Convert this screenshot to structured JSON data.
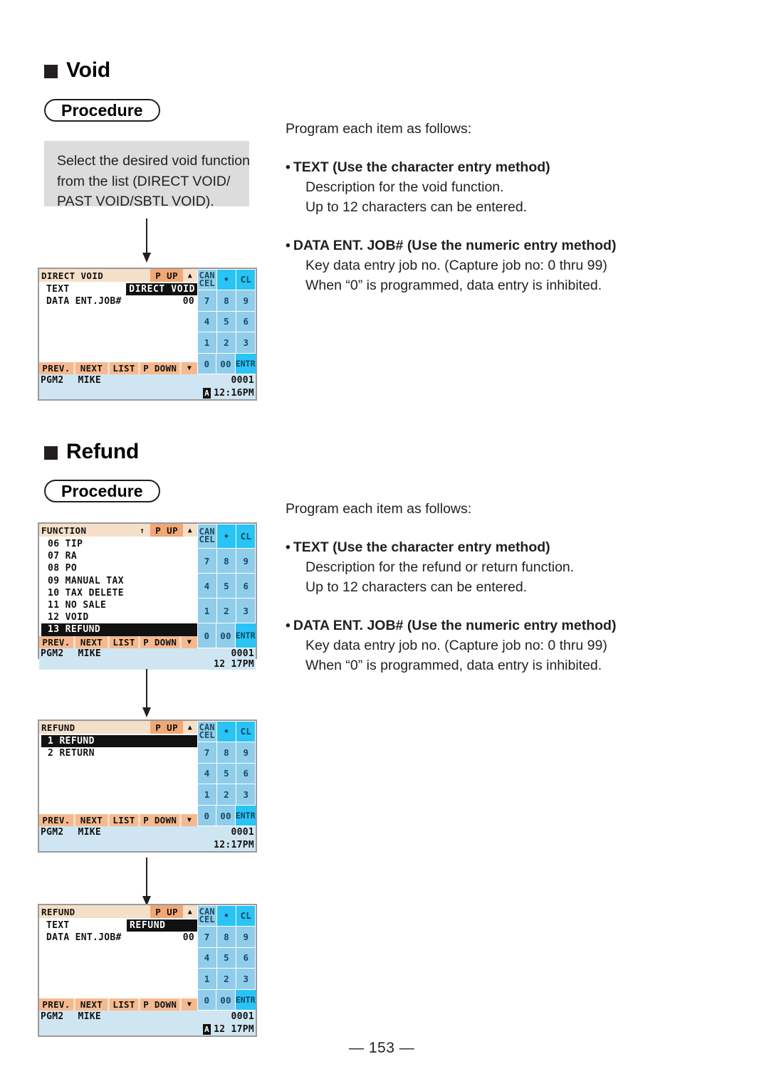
{
  "page": {
    "number_label": "— 153 —"
  },
  "sections": [
    {
      "heading": "Void",
      "procedure_label": "Procedure",
      "instruction": [
        "Select the desired void function",
        "from the list (DIRECT VOID/",
        "PAST VOID/SBTL VOID)."
      ],
      "prose": {
        "lead": "Program each item as follows:",
        "items": [
          {
            "title": "TEXT (Use the character entry method)",
            "lines": [
              "Description for the void function.",
              "Up to 12 characters can be entered."
            ]
          },
          {
            "title": "DATA ENT. JOB# (Use the numeric entry method)",
            "lines": [
              "Key data entry job no. (Capture job no: 0 thru 99)",
              "When “0” is programmed, data entry is inhibited."
            ]
          }
        ]
      }
    },
    {
      "heading": "Refund",
      "procedure_label": "Procedure",
      "prose": {
        "lead": "Program each item as follows:",
        "items": [
          {
            "title": "TEXT (Use the character entry method)",
            "lines": [
              "Description for the refund or return function.",
              "Up to 12 characters can be entered."
            ]
          },
          {
            "title": "DATA ENT. JOB# (Use the numeric entry method)",
            "lines": [
              "Key data entry job no. (Capture job no: 0 thru 99)",
              "When “0” is programmed, data entry is inhibited."
            ]
          }
        ]
      }
    }
  ],
  "keypad": {
    "cancel_line1": "CAN",
    "cancel_line2": "CEL",
    "decimal": "•",
    "clear": "CL",
    "k7": "7",
    "k8": "8",
    "k9": "9",
    "k4": "4",
    "k5": "5",
    "k6": "6",
    "k1": "1",
    "k2": "2",
    "k3": "3",
    "k0": "0",
    "k00": "00",
    "enter": "ENTR"
  },
  "function_bar": {
    "prev": "PREV.",
    "next": "NEXT",
    "list": "LIST",
    "page_down": "P DOWN",
    "down_arrow": "▼"
  },
  "screens": [
    {
      "id": "direct-void-program",
      "title": "DIRECT VOID",
      "scroll_up_marker": "",
      "page_up": "P UP",
      "up_arrow": "▲",
      "rows": [
        {
          "label": "TEXT",
          "value": "DIRECT VOID",
          "style": "inverse"
        },
        {
          "label": "DATA ENT.JOB#",
          "value": "00",
          "style": "plain"
        }
      ],
      "list_items": [],
      "status": {
        "mode": "PGM2",
        "clerk": "MIKE",
        "consec": "0001"
      },
      "clock": {
        "badge": "A",
        "time": "12:16PM"
      }
    },
    {
      "id": "function-list",
      "title": "FUNCTION",
      "scroll_up_marker": "↑",
      "page_up": "P UP",
      "up_arrow": "▲",
      "rows": [],
      "list_items": [
        {
          "text": "06 TIP",
          "selected": false
        },
        {
          "text": "07 RA",
          "selected": false
        },
        {
          "text": "08 PO",
          "selected": false
        },
        {
          "text": "09 MANUAL TAX",
          "selected": false
        },
        {
          "text": "10 TAX DELETE",
          "selected": false
        },
        {
          "text": "11 NO SALE",
          "selected": false
        },
        {
          "text": "12 VOID",
          "selected": false
        },
        {
          "text": "13 REFUND",
          "selected": true
        }
      ],
      "status": {
        "mode": "PGM2",
        "clerk": "MIKE",
        "consec": "0001"
      },
      "clock": {
        "badge": "",
        "time": "12 17PM"
      }
    },
    {
      "id": "refund-list",
      "title": "REFUND",
      "scroll_up_marker": "",
      "page_up": "P UP",
      "up_arrow": "▲",
      "rows": [],
      "list_items": [
        {
          "text": "1 REFUND",
          "selected": true
        },
        {
          "text": "2 RETURN",
          "selected": false
        }
      ],
      "status": {
        "mode": "PGM2",
        "clerk": "MIKE",
        "consec": "0001"
      },
      "clock": {
        "badge": "",
        "time": "12:17PM"
      }
    },
    {
      "id": "refund-program",
      "title": "REFUND",
      "scroll_up_marker": "",
      "page_up": "P UP",
      "up_arrow": "▲",
      "rows": [
        {
          "label": "TEXT",
          "value": "REFUND",
          "style": "inverse"
        },
        {
          "label": "DATA ENT.JOB#",
          "value": "00",
          "style": "plain"
        }
      ],
      "list_items": [],
      "status": {
        "mode": "PGM2",
        "clerk": "MIKE",
        "consec": "0001"
      },
      "clock": {
        "badge": "A",
        "time": "12 17PM"
      }
    }
  ],
  "colors": {
    "titlebar": "#f6dfc8",
    "page_up": "#f0a875",
    "function_key": "#f6b98f",
    "status": "#cfe6f2",
    "key": "#8fcdeb",
    "key_bright": "#29c3f5",
    "instruction_box": "#dcdcdc",
    "ink": "#231f20"
  }
}
